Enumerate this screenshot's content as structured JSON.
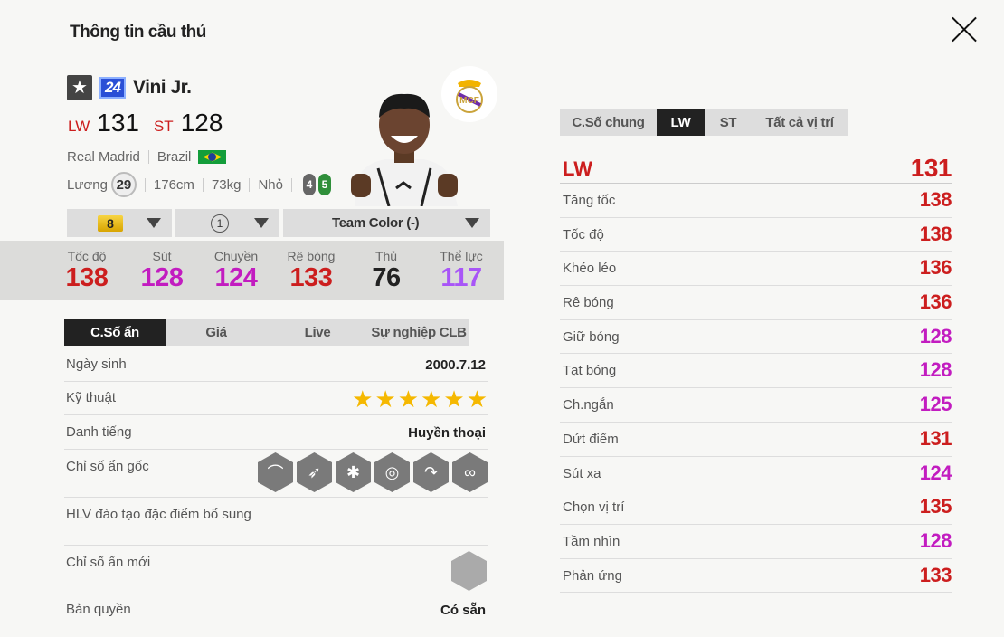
{
  "page_title": "Thông tin cầu thủ",
  "colors": {
    "red": "#cc1e1e",
    "purple": "#c21cc0",
    "dark": "#222222",
    "violet": "#a855f7"
  },
  "player": {
    "season": "24",
    "name": "Vini Jr.",
    "ovr": [
      {
        "pos": "LW",
        "val": "131"
      },
      {
        "pos": "ST",
        "val": "128"
      }
    ],
    "club": "Real Madrid",
    "nation": "Brazil",
    "salary_label": "Lương",
    "salary": "29",
    "height": "176cm",
    "weight": "73kg",
    "body": "Nhỏ",
    "weak_foot": "4",
    "strong_foot": "5"
  },
  "selects": {
    "grade": "8",
    "level": "1",
    "team_color": "Team Color (-)"
  },
  "stats": [
    {
      "label": "Tốc độ",
      "value": "138",
      "color": "#cc1e1e"
    },
    {
      "label": "Sút",
      "value": "128",
      "color": "#c21cc0"
    },
    {
      "label": "Chuyền",
      "value": "124",
      "color": "#c21cc0"
    },
    {
      "label": "Rê bóng",
      "value": "133",
      "color": "#cc1e1e"
    },
    {
      "label": "Thủ",
      "value": "76",
      "color": "#222222"
    },
    {
      "label": "Thể lực",
      "value": "117",
      "color": "#a855f7"
    }
  ],
  "left_tabs": [
    "C.Số ẩn",
    "Giá",
    "Live",
    "Sự nghiệp CLB"
  ],
  "details": {
    "birthday_label": "Ngày sinh",
    "birthday": "2000.7.12",
    "skill_label": "Kỹ thuật",
    "skill_stars": 6,
    "fame_label": "Danh tiếng",
    "fame": "Huyền thoại",
    "traits_label": "Chỉ số ẩn gốc",
    "coach_label": "HLV đào tạo đặc điểm bổ sung",
    "new_traits_label": "Chỉ số ẩn mới",
    "license_label": "Bản quyền",
    "license": "Có sẵn"
  },
  "traits_icons": [
    "finesse-shot-icon",
    "speed-dribbler-icon",
    "flair-icon",
    "outside-foot-icon",
    "power-header-icon",
    "dribble-icon"
  ],
  "right_tabs": [
    "C.Số chung",
    "LW",
    "ST",
    "Tất cả vị trí"
  ],
  "attributes_head": {
    "label": "LW",
    "value": "131"
  },
  "attributes": [
    {
      "label": "Tăng tốc",
      "value": "138",
      "color": "#cc1e1e"
    },
    {
      "label": "Tốc độ",
      "value": "138",
      "color": "#cc1e1e"
    },
    {
      "label": "Khéo léo",
      "value": "136",
      "color": "#cc1e1e"
    },
    {
      "label": "Rê bóng",
      "value": "136",
      "color": "#cc1e1e"
    },
    {
      "label": "Giữ bóng",
      "value": "128",
      "color": "#c21cc0"
    },
    {
      "label": "Tạt bóng",
      "value": "128",
      "color": "#c21cc0"
    },
    {
      "label": "Ch.ngắn",
      "value": "125",
      "color": "#c21cc0"
    },
    {
      "label": "Dứt điểm",
      "value": "131",
      "color": "#cc1e1e"
    },
    {
      "label": "Sút xa",
      "value": "124",
      "color": "#c21cc0"
    },
    {
      "label": "Chọn vị trí",
      "value": "135",
      "color": "#cc1e1e"
    },
    {
      "label": "Tầm nhìn",
      "value": "128",
      "color": "#c21cc0"
    },
    {
      "label": "Phản ứng",
      "value": "133",
      "color": "#cc1e1e"
    }
  ]
}
